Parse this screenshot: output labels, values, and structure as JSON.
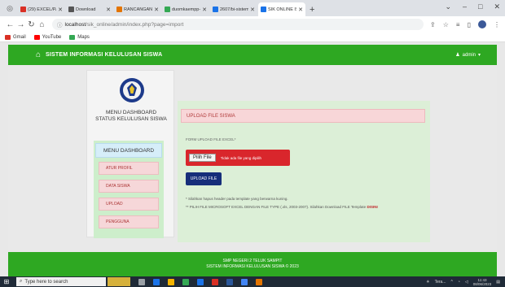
{
  "browser": {
    "tabs": [
      {
        "label": "(29) EXCEL/PAME",
        "color": "#d93025",
        "active": false
      },
      {
        "label": "Download",
        "color": "#555555",
        "active": false
      },
      {
        "label": "RANCANGAN SIK",
        "color": "#e37400",
        "active": false
      },
      {
        "label": "duomkaempp-p",
        "color": "#34a853",
        "active": false
      },
      {
        "label": "2607/bi-sistem-in",
        "color": "#1a73e8",
        "active": false
      },
      {
        "label": "SIK ONLINE IS S",
        "color": "#1a73e8",
        "active": true
      }
    ],
    "url_host": "localhost",
    "url_path": "/sik_online/admin/index.php?page=import",
    "bookmarks": [
      {
        "label": "Gmail",
        "color": "#d93025"
      },
      {
        "label": "YouTube",
        "color": "#ff0000"
      },
      {
        "label": "Maps",
        "color": "#34a853"
      }
    ]
  },
  "app": {
    "brand": "SISTEM INFORMASI KELULUSAN SISWA",
    "user": "admin"
  },
  "sidebar": {
    "title_line1": "MENU DASHBOARD",
    "title_line2": "STATUS KELULUSAN SISWA",
    "menu_head": "MENU DASHBOARD",
    "items": [
      "ATUR PROFIL",
      "DATA SISWA",
      "UPLOAD",
      "PENGGUNA"
    ]
  },
  "main": {
    "heading": "UPLOAD FILE SISWA",
    "form_label": "FORM UPLOAD FILE EXCEL*",
    "choose_button": "Pilih File",
    "no_file_text": "Tidak ada file yang dipilih",
    "upload_button": "UPLOAD FILE",
    "note1": "* Silahkan hapus header pada template yang berwarna kuning.",
    "note2": "** PILIH FILE MICROSOFT EXCEL DENGAN FILE TYPE (.xls, 2003-2007). Silahkan Download FILE Template",
    "note2_link": "DISINI"
  },
  "footer": {
    "line1": "SMP NEGERI 2 TELUK SAMPIT",
    "line2": "SISTEM INFORMASI KELULUSAN SISWA © 2023"
  },
  "taskbar": {
    "search_placeholder": "Type here to search",
    "weather": "Tera...",
    "time": "11:43",
    "date": "08/06/2023"
  }
}
